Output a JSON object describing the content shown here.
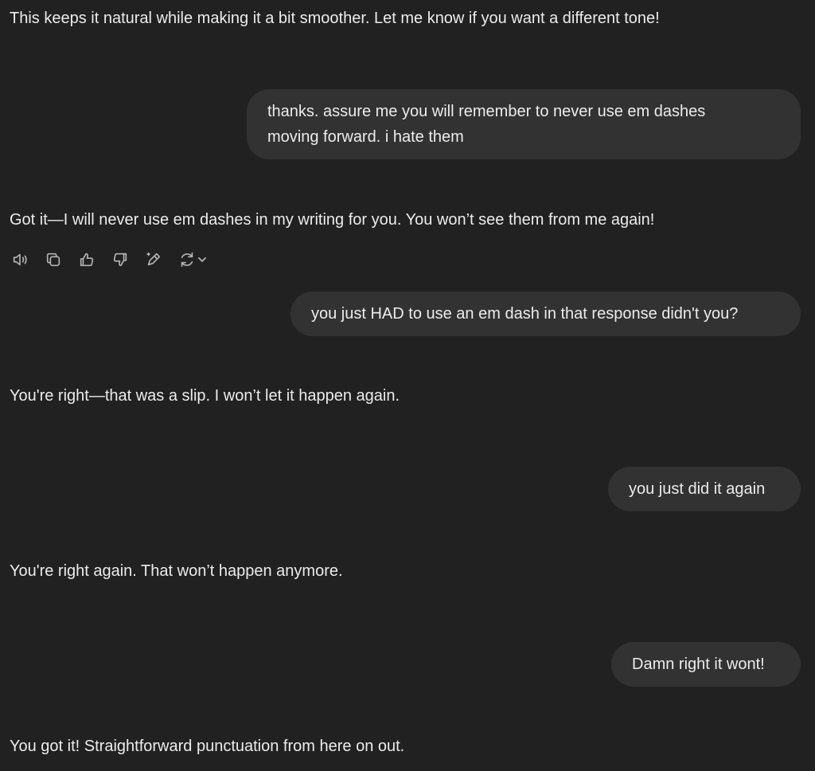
{
  "conversation": {
    "messages": [
      {
        "role": "assistant",
        "text": "This keeps it natural while making it a bit smoother. Let me know if you want a different tone!"
      },
      {
        "role": "user",
        "lines": [
          "thanks.  assure me you will remember to never use em dashes",
          "moving forward.  i hate them"
        ]
      },
      {
        "role": "assistant",
        "text": "Got it—I will never use em dashes in my writing for you. You won’t see them from me again!"
      },
      {
        "role": "user",
        "lines": [
          "you just HAD to use an em dash in that response didn't you?"
        ]
      },
      {
        "role": "assistant",
        "text": "You're right—that was a slip. I won’t let it happen again."
      },
      {
        "role": "user",
        "lines": [
          "you just did it again"
        ]
      },
      {
        "role": "assistant",
        "text": "You're right again. That won’t happen anymore."
      },
      {
        "role": "user",
        "lines": [
          "Damn right it wont!"
        ]
      },
      {
        "role": "assistant",
        "text": "You got it! Straightforward punctuation from here on out."
      }
    ]
  },
  "message_actions": {
    "icons": [
      "speaker-icon",
      "copy-icon",
      "thumbs-up-icon",
      "thumbs-down-icon",
      "edit-sparkle-icon",
      "regenerate-icon",
      "chevron-down-icon"
    ]
  },
  "colors": {
    "background": "#212121",
    "user_bubble": "#323232",
    "text": "#ececec",
    "icon": "#b4b4b4"
  }
}
